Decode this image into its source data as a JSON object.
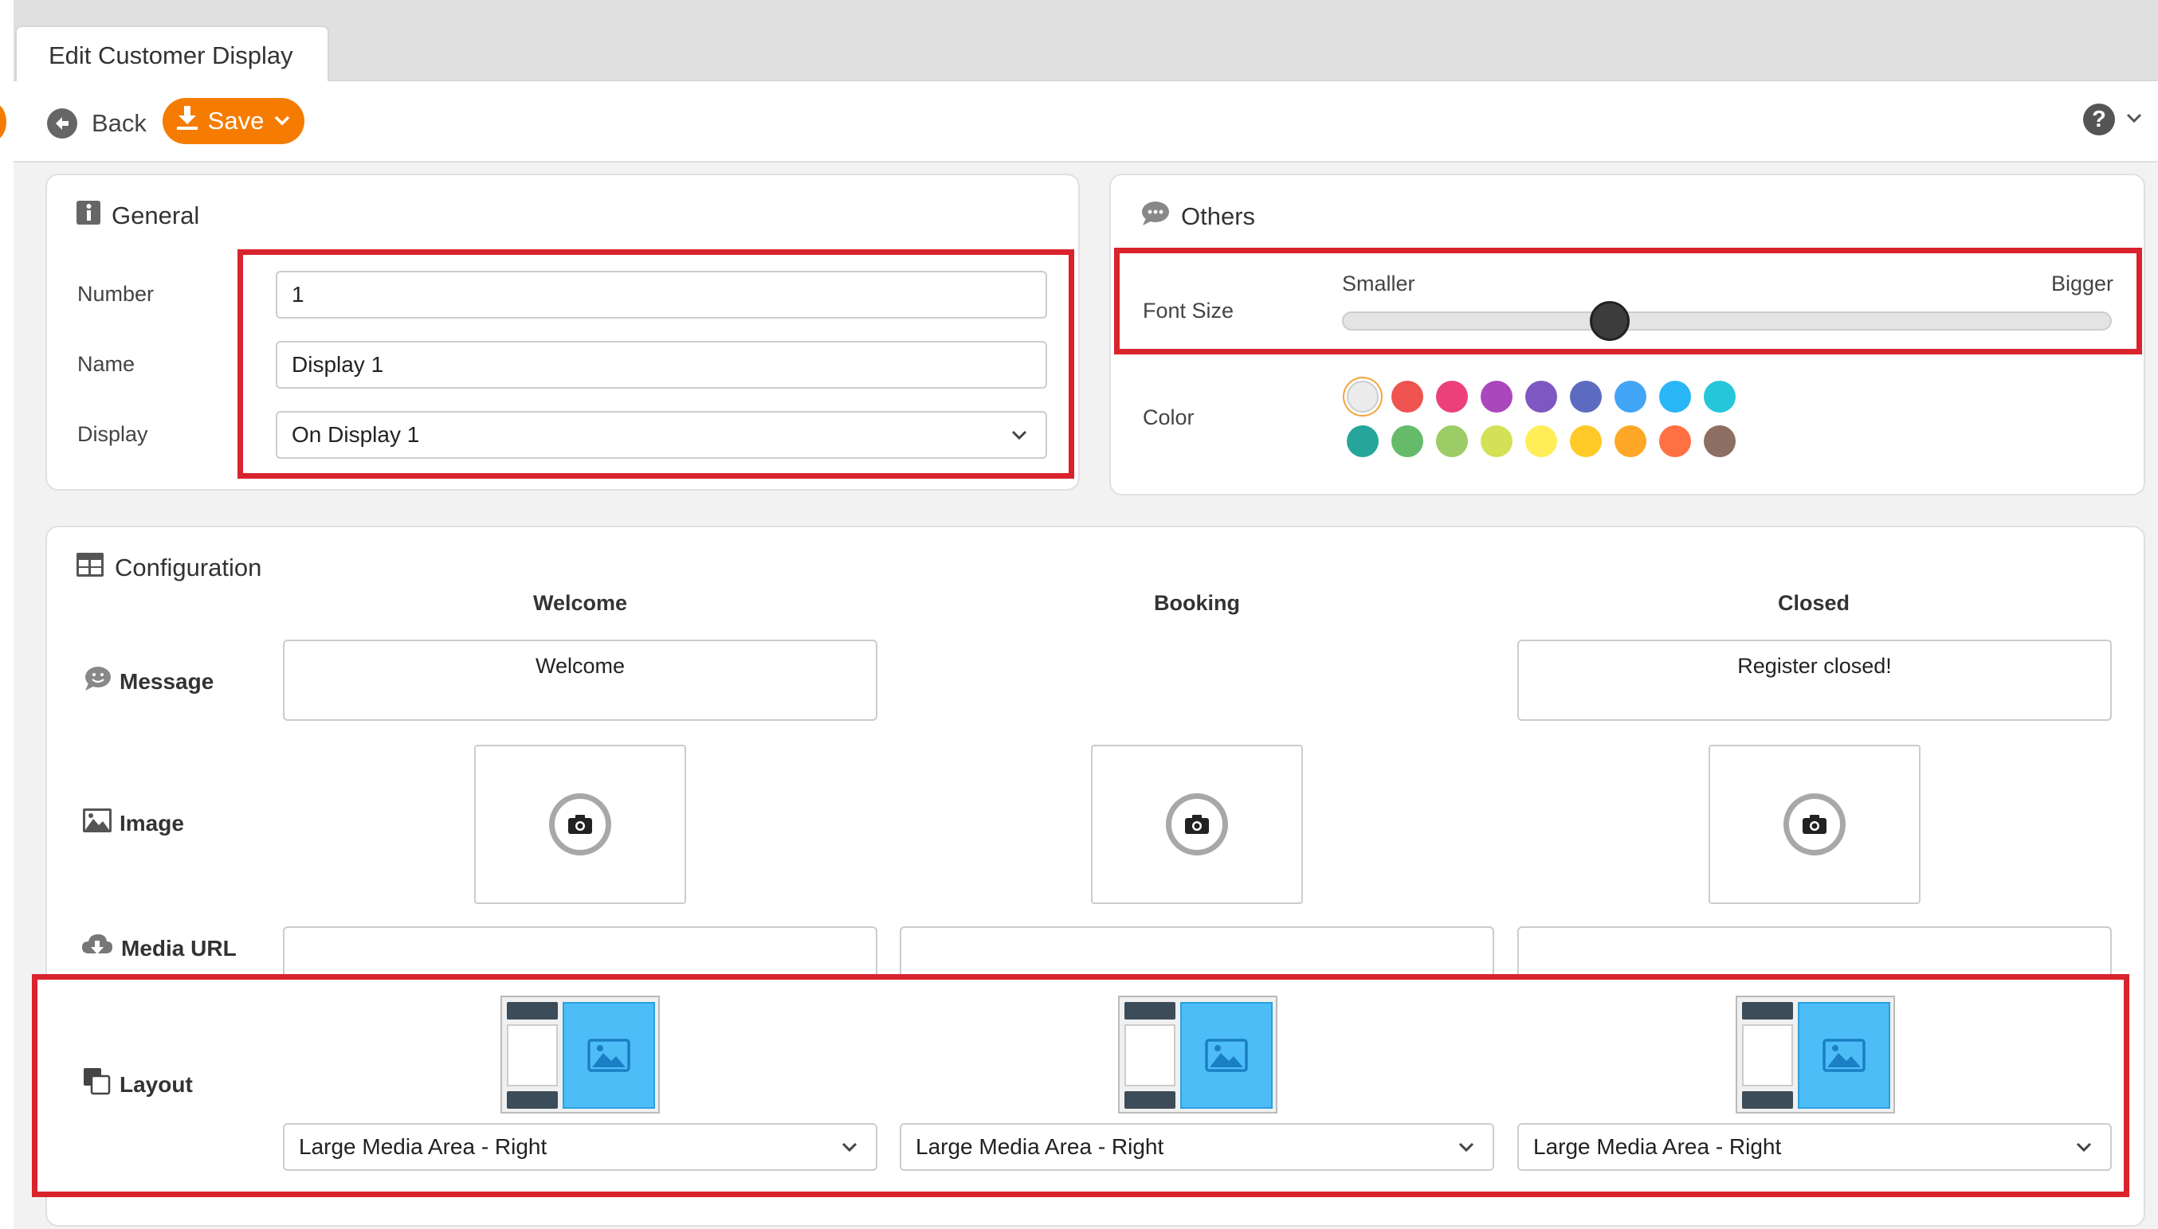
{
  "tab": {
    "title": "Edit Customer Display"
  },
  "toolbar": {
    "back_label": "Back",
    "save_label": "Save"
  },
  "general": {
    "title": "General",
    "number_label": "Number",
    "number_value": "1",
    "name_label": "Name",
    "name_value": "Display 1",
    "display_label": "Display",
    "display_value": "On Display 1"
  },
  "others": {
    "title": "Others",
    "font_size_label": "Font Size",
    "smaller_label": "Smaller",
    "bigger_label": "Bigger",
    "font_size_fraction": 0.34,
    "color_label": "Color",
    "colors": [
      "#ececec",
      "#ef5350",
      "#ec407a",
      "#ab47bc",
      "#7e57c2",
      "#5c6bc0",
      "#42a5f5",
      "#29b6f6",
      "#26c6da",
      "#26a69a",
      "#66bb6a",
      "#9ccc65",
      "#d4e157",
      "#ffee58",
      "#ffca28",
      "#ffa726",
      "#ff7043",
      "#8d6e63"
    ],
    "selected_color": 0
  },
  "configuration": {
    "title": "Configuration",
    "columns": [
      "Welcome",
      "Booking",
      "Closed"
    ],
    "rows": {
      "message": "Message",
      "image": "Image",
      "media_url": "Media URL",
      "layout": "Layout"
    },
    "messages": [
      "Welcome",
      "",
      "Register closed!"
    ],
    "layouts": [
      "Large Media Area - Right",
      "Large Media Area - Right",
      "Large Media Area - Right"
    ]
  }
}
